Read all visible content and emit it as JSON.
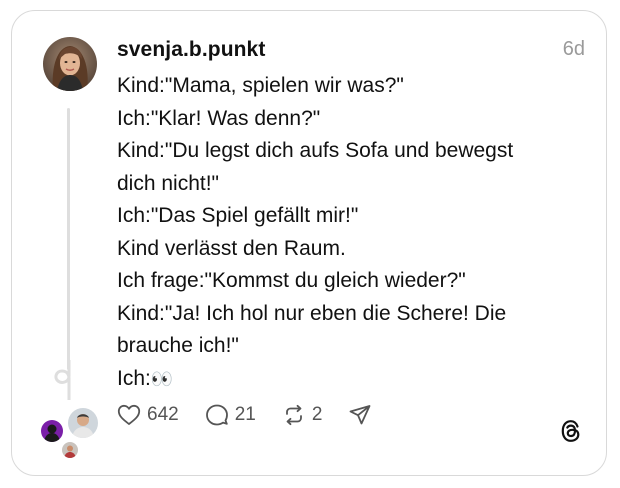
{
  "post": {
    "username": "svenja.b.punkt",
    "timestamp": "6d",
    "lines": [
      "Kind:\"Mama, spielen wir was?\"",
      "Ich:\"Klar! Was denn?\"",
      "Kind:\"Du legst dich aufs Sofa und bewegst",
      "dich nicht!\"",
      "Ich:\"Das Spiel gefällt mir!\"",
      "Kind verlässt den Raum.",
      "Ich frage:\"Kommst du gleich wieder?\"",
      "Kind:\"Ja! Ich hol nur eben die Schere! Die",
      "brauche ich!\""
    ],
    "last_line_prefix": "Ich:",
    "last_line_emoji": "👀"
  },
  "actions": {
    "likes": "642",
    "replies": "21",
    "reposts": "2"
  },
  "icons": {
    "like": "heart-icon",
    "reply": "speech-bubble-icon",
    "repost": "repost-icon",
    "share": "send-icon",
    "brand": "threads-logo-icon"
  },
  "colors": {
    "text": "#111111",
    "muted": "#9a9a9a",
    "icon": "#555555",
    "border": "#d9d9d9"
  }
}
